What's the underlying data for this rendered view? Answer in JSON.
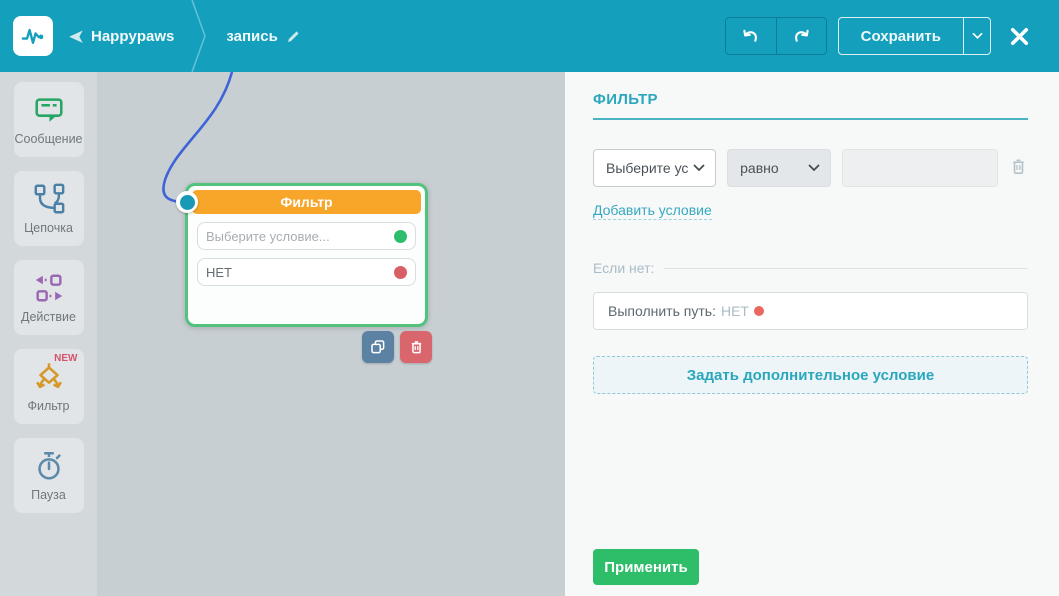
{
  "colors": {
    "topbar_teal": "#14a0bd",
    "accent_teal": "#2aa7bd",
    "node_header_orange": "#f8a629",
    "selection_green": "#52c27d",
    "apply_green": "#2ebd68",
    "yes_dot_green": "#2dbd6c",
    "no_dot_red": "#d95f66",
    "path_dot_red": "#e8685f",
    "wire_blue": "#3f64d7",
    "copy_button_slate": "#5b82a2",
    "delete_button_red": "#d9666c"
  },
  "topbar": {
    "bot_name": "Happypaws",
    "flow_name": "запись",
    "save_label": "Сохранить"
  },
  "sidebar": {
    "items": [
      {
        "label": "Сообщение"
      },
      {
        "label": "Цепочка"
      },
      {
        "label": "Действие"
      },
      {
        "label": "Фильтр",
        "badge": "NEW"
      },
      {
        "label": "Пауза"
      }
    ]
  },
  "canvas": {
    "node": {
      "title": "Фильтр",
      "rows": [
        {
          "text": "Выберите условие...",
          "dot": "green"
        },
        {
          "text": "НЕТ",
          "dot": "red"
        }
      ]
    }
  },
  "panel": {
    "title": "ФИЛЬТР",
    "condition_select": "Выберите ус",
    "operator_select": "равно",
    "value_input": "",
    "add_condition_link": "Добавить условие",
    "else_label": "Если нет:",
    "path_label": "Выполнить путь:",
    "path_value": "НЕТ",
    "extra_condition_button": "Задать дополнительное условие",
    "apply_button": "Применить"
  }
}
